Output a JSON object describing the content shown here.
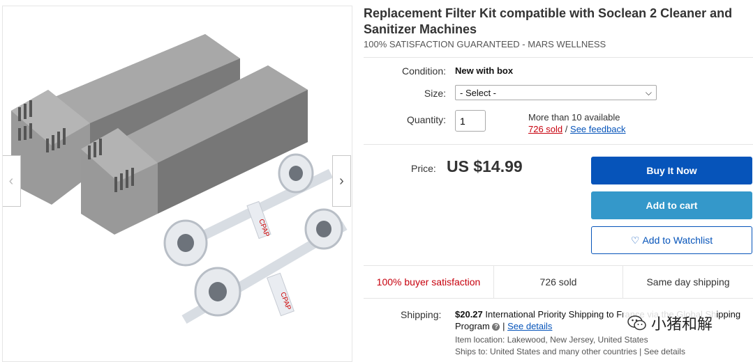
{
  "title": "Replacement Filter Kit compatible with Soclean 2 Cleaner and Sanitizer Machines",
  "subtitle": "100% SATISFACTION GUARANTEED - MARS WELLNESS",
  "condition": {
    "label": "Condition:",
    "value": "New with box"
  },
  "size": {
    "label": "Size:",
    "selected": "- Select -"
  },
  "quantity": {
    "label": "Quantity:",
    "value": "1",
    "available": "More than 10 available",
    "sold_link": "726 sold",
    "separator": "/",
    "feedback_link": "See feedback"
  },
  "price": {
    "label": "Price:",
    "value": "US $14.99"
  },
  "buttons": {
    "buy_now": "Buy It Now",
    "add_to_cart": "Add to cart",
    "watchlist": "Add to Watchlist",
    "heart_icon": "♡"
  },
  "stats": [
    {
      "text": "100% buyer satisfaction"
    },
    {
      "text": "726 sold"
    },
    {
      "text": "Same day shipping"
    }
  ],
  "shipping": {
    "label": "Shipping:",
    "cost": "$20.27",
    "method": "International Priority Shipping to France via the Global Shipping Program",
    "see_details": "See details",
    "location": "Item location:  Lakewood, New Jersey, United States",
    "ships_to": "Ships to:  United States and many other countries | See details"
  },
  "image": {
    "label_text": "CPAP"
  },
  "watermark": {
    "text": "小猪和解"
  },
  "colors": {
    "primary_blue": "#0654ba",
    "cart_blue": "#3498ca",
    "red": "#c7000d"
  }
}
